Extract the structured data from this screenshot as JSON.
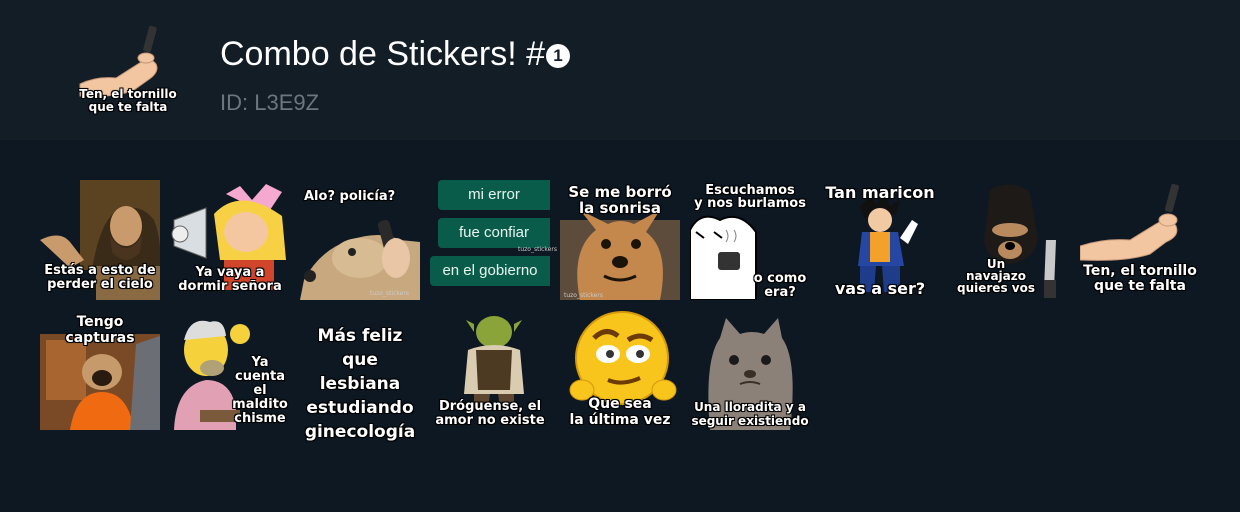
{
  "pack": {
    "title": "Combo de Stickers! #",
    "title_badge": "1",
    "id_text": "ID: L3E9Z",
    "thumbnail_caption": "Ten, el tornillo\nque te falta"
  },
  "stickers": [
    {
      "name": "jesus",
      "caption": "Estás a esto de\nperder el cielo"
    },
    {
      "name": "helga-megaphone",
      "caption": "Ya vaya a\ndormir señora"
    },
    {
      "name": "dog-phone",
      "caption": "Alo? policía?",
      "watermark": "tuzo_stickers"
    },
    {
      "name": "chat-bubbles",
      "bubbles": [
        "mi error",
        "fue confiar",
        "en el gobierno"
      ],
      "watermark": "tuzo_stickers"
    },
    {
      "name": "dog-smile",
      "caption": "Se me borró\nla sonrisa",
      "watermark": "tuzo_stickers"
    },
    {
      "name": "flork-coffee",
      "caption_top": "Escuchamos\ny nos burlamos",
      "caption_bottom": "o como\nera?"
    },
    {
      "name": "vegito",
      "caption_top": "Tan maricon",
      "caption_bottom": "vas a ser?"
    },
    {
      "name": "balaclava-dog",
      "caption": "Un\nnavajazo\nquieres vos"
    },
    {
      "name": "screw-hand",
      "caption": "Ten, el tornillo\nque te falta"
    },
    {
      "name": "pug-laptop",
      "caption": "Tengo capturas"
    },
    {
      "name": "grandpa-simpson",
      "caption": "Ya\ncuenta\nel\nmaldito\nchisme"
    },
    {
      "name": "text-only",
      "caption": "Más feliz\nque lesbiana\nestudiando\nginecología"
    },
    {
      "name": "shrek",
      "caption": "Dróguense, el\namor no existe"
    },
    {
      "name": "emoji-face",
      "caption": "Que sea\nla última vez"
    },
    {
      "name": "sad-cat",
      "caption": "Una lloradita y a\nseguir existiendo"
    }
  ]
}
